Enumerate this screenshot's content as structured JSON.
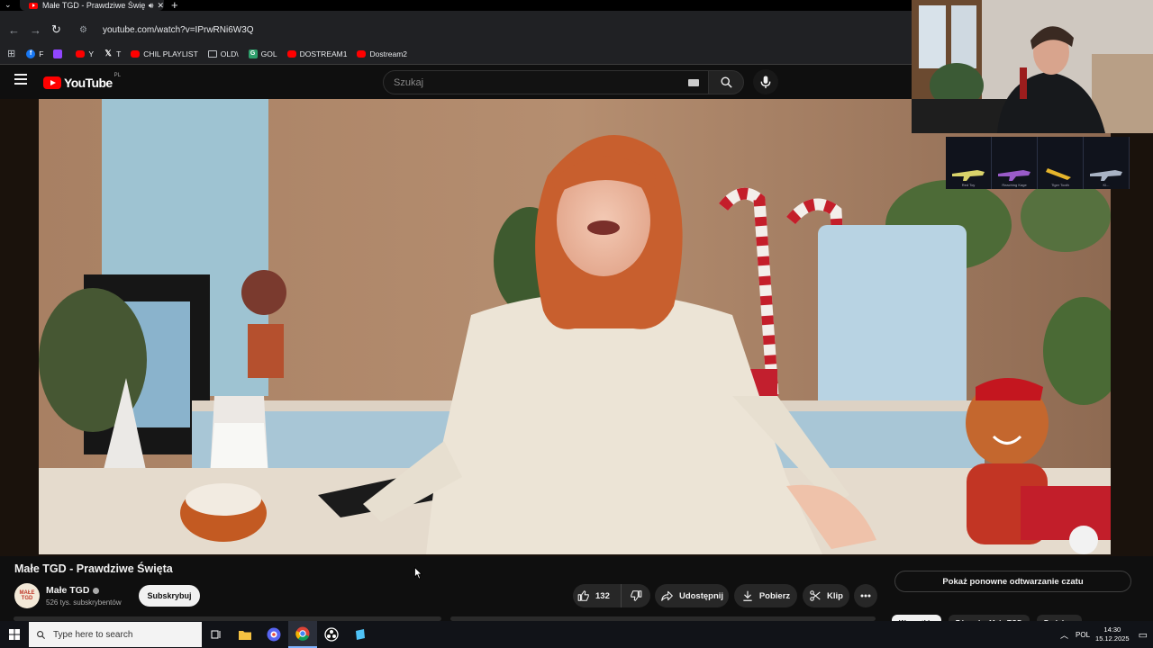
{
  "browser": {
    "tab_title": "Małe TGD - Prawdziwe Święta",
    "url": "youtube.com/watch?v=IPrwRNi6W3Q",
    "bookmarks": [
      {
        "label": "F",
        "icon": "facebook-icon",
        "color": "#1877f2"
      },
      {
        "label": "",
        "icon": "twitch-icon",
        "color": "#9146ff"
      },
      {
        "label": "Y",
        "icon": "youtube-icon",
        "color": "#ff0000"
      },
      {
        "label": "T",
        "icon": "x-icon",
        "color": "#ffffff"
      },
      {
        "label": "CHIL PLAYLIST",
        "icon": "youtube-icon",
        "color": "#ff0000"
      },
      {
        "label": "OLD\\",
        "icon": "folder-icon",
        "color": "#bdc1c6"
      },
      {
        "label": "GOL",
        "icon": "gol-icon",
        "color": "#2e9e6b"
      },
      {
        "label": "DOSTREAM1",
        "icon": "youtube-icon",
        "color": "#ff0000"
      },
      {
        "label": "Dostream2",
        "icon": "youtube-icon",
        "color": "#ff0000"
      }
    ]
  },
  "youtube": {
    "logo_text": "YouTube",
    "country_code": "PL",
    "search_placeholder": "Szukaj"
  },
  "video": {
    "title": "Małe TGD - Prawdziwe Święta",
    "channel": "Małe TGD",
    "channel_avatar_text": "MAŁE TGD",
    "subscribers": "526 tys. subskrybentów",
    "subscribe_label": "Subskrybuj",
    "like_count": "132",
    "share_label": "Udostępnij",
    "download_label": "Pobierz",
    "clip_label": "Klip"
  },
  "sidebar": {
    "chat_replay_label": "Pokaż ponowne odtwarzanie czatu",
    "chips": [
      "Wszystkie",
      "Z kanału: Małe TGD",
      "Podobne"
    ]
  },
  "skins": [
    "Red Toy",
    "Reaching Kage",
    "Tiger Tooth",
    "Kl..."
  ],
  "taskbar": {
    "search_placeholder": "Type here to search",
    "language": "POL",
    "time": "14:30",
    "date": "15.12.2025"
  },
  "colors": {
    "youtube_red": "#ff0000",
    "background": "#0f0f0f",
    "pill": "#272727"
  }
}
